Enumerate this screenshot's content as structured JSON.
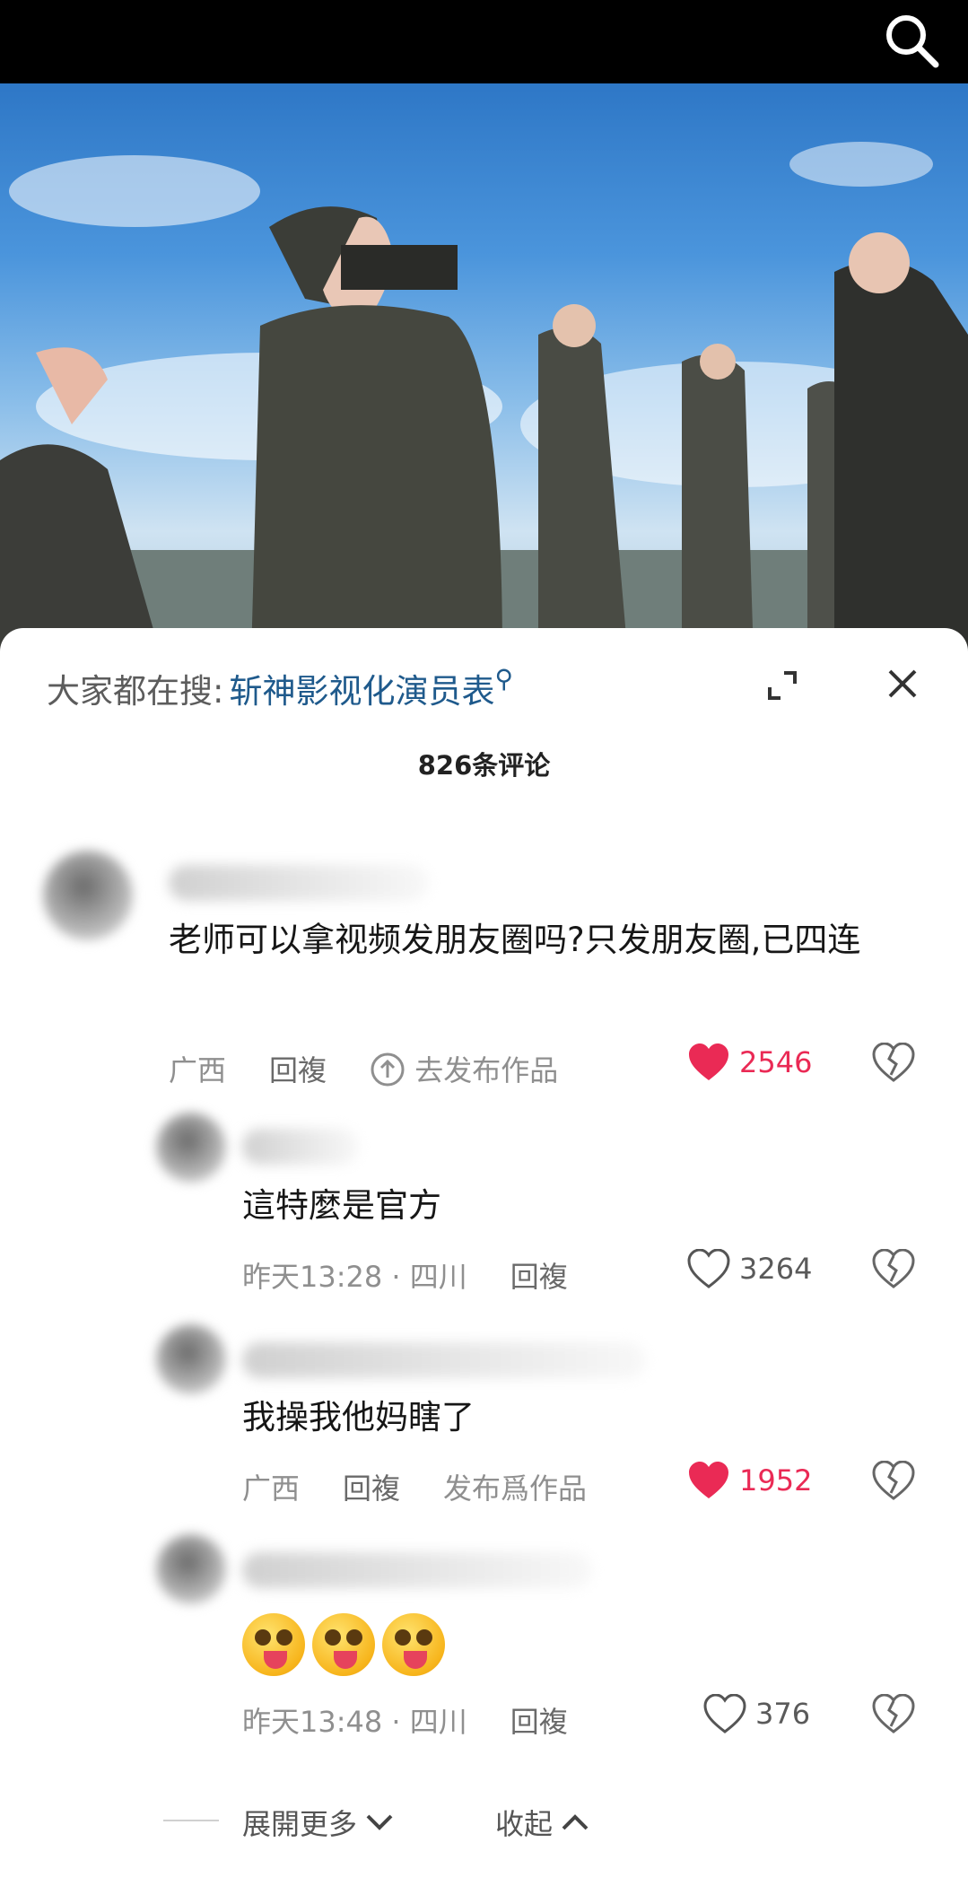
{
  "hot_search": {
    "prefix": "大家都在搜:",
    "term": "斩神影视化演员表",
    "mag": "⚲"
  },
  "comment_count": "826条评论",
  "comments": [
    {
      "text": "老师可以拿视频发朋友圈吗?只发朋友圈,已四连",
      "location": "广西",
      "reply": "回複",
      "post_action": "去发布作品",
      "likes": "2546",
      "liked": true
    },
    {
      "text": "這特麼是官方",
      "time": "昨天13:28 · 四川",
      "reply": "回複",
      "likes": "3264",
      "liked": false
    },
    {
      "text": "我操我他妈瞎了",
      "location": "广西",
      "reply": "回複",
      "post_action": "发布爲作品",
      "likes": "1952",
      "liked": true
    },
    {
      "time": "昨天13:48 · 四川",
      "reply": "回複",
      "likes": "376",
      "liked": false,
      "emoji_count": 3
    }
  ],
  "footer": {
    "expand": "展開更多",
    "collapse": "收起"
  },
  "colors": {
    "accent_red": "#ea2a55",
    "link_blue": "#1f5a8c"
  },
  "icons": [
    "search-icon",
    "expand-icon",
    "close-icon",
    "heart-icon",
    "broken-heart-icon",
    "upload-icon",
    "chevron-down-icon",
    "chevron-up-icon"
  ]
}
